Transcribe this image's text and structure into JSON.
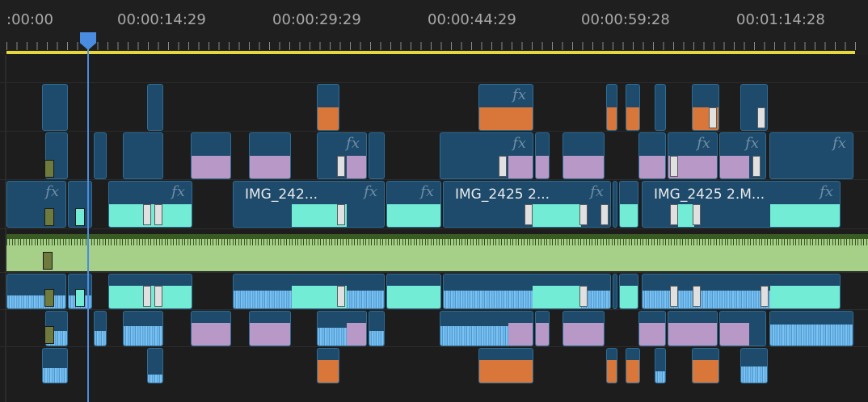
{
  "timecodes": [
    ":00:00",
    "00:00:14:29",
    "00:00:29:29",
    "00:00:44:29",
    "00:00:59:28",
    "00:01:14:28"
  ],
  "clip_labels": {
    "v1_a": "IMG_242...",
    "v1_b": "IMG_2425 2...",
    "v1_c": "IMG_2425 2.M..."
  },
  "fx_glyph": "fx",
  "colors": {
    "clip_body": "#1e4a6b",
    "orange": "#d9763a",
    "purple": "#b898c6",
    "cyan": "#72ecd4",
    "audio_green": "#a6cf88",
    "playhead": "#4a8de0",
    "work_area": "#e6d83a"
  },
  "icons": [
    "playhead-icon",
    "marker-icon",
    "transition-icon",
    "fx-badge-icon"
  ]
}
